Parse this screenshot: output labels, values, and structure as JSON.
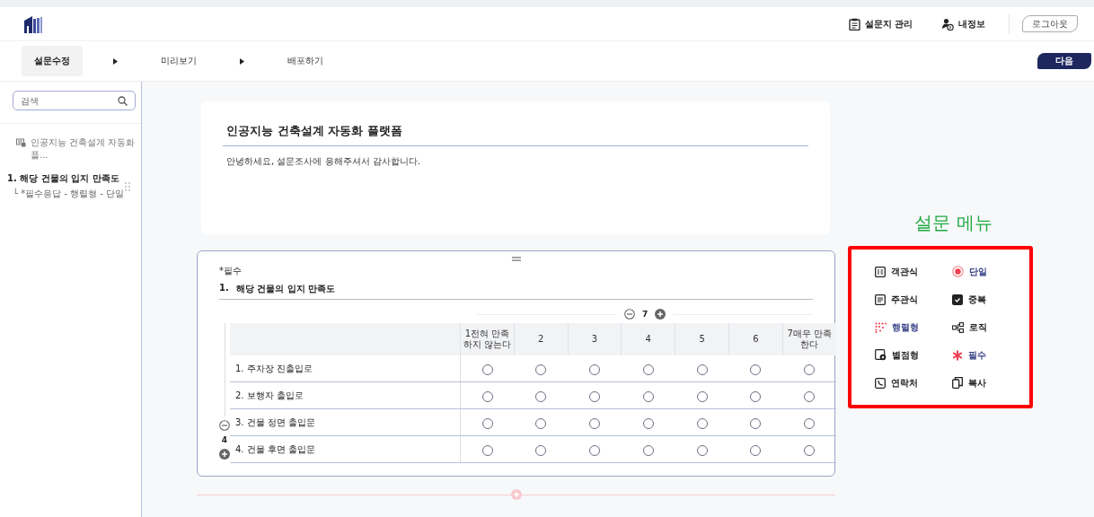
{
  "header": {
    "nav": [
      {
        "label": "설문지 관리",
        "kind": "clipboard"
      },
      {
        "label": "내정보",
        "kind": "user"
      }
    ],
    "logout": "로그아웃"
  },
  "steps": [
    {
      "label": "설문수정",
      "selected": true
    },
    {
      "label": "미리보기",
      "selected": false
    },
    {
      "label": "배포하기",
      "selected": false
    }
  ],
  "next_button": "다음",
  "sidebar": {
    "search": {
      "placeholder": "검색"
    },
    "survey_title": "인공지능 건축설계 자동화 플...",
    "questions": [
      {
        "title": "1. 해당 건물의 입지 만족도",
        "meta": "└ *필수응답 - 행렬형 - 단일",
        "selected": true
      }
    ]
  },
  "title_card": {
    "title": "인공지능 건축설계 자동화 플랫폼",
    "description": "안녕하세요, 설문조사에 응해주셔서 감사합니다."
  },
  "question": {
    "required_label": "*필수",
    "number": "1.",
    "title": "해당 건물의 입지 만족도",
    "scale_count": "7",
    "row_count": "4",
    "columns": [
      "1전혀 만족하지 않는다",
      "2",
      "3",
      "4",
      "5",
      "6",
      "7매우 만족한다"
    ],
    "rows": [
      {
        "label": "1. 주차장 진출입로",
        "cells": [
          {
            "selected": false
          },
          {
            "selected": false
          },
          {
            "selected": false
          },
          {
            "selected": false
          },
          {
            "selected": false
          },
          {
            "selected": false
          },
          {
            "selected": false
          }
        ]
      },
      {
        "label": "2. 보행자 출입로",
        "cells": [
          {
            "selected": false
          },
          {
            "selected": false
          },
          {
            "selected": false
          },
          {
            "selected": false
          },
          {
            "selected": false
          },
          {
            "selected": false
          },
          {
            "selected": false
          }
        ]
      },
      {
        "label": "3. 건물 정면 출입문",
        "cells": [
          {
            "selected": false
          },
          {
            "selected": false
          },
          {
            "selected": false
          },
          {
            "selected": false
          },
          {
            "selected": false
          },
          {
            "selected": false
          },
          {
            "selected": false
          }
        ]
      },
      {
        "label": "4. 건물 후면 출입문",
        "cells": [
          {
            "selected": false
          },
          {
            "selected": false
          },
          {
            "selected": false
          },
          {
            "selected": false
          },
          {
            "selected": false
          },
          {
            "selected": false
          },
          {
            "selected": false
          }
        ]
      }
    ]
  },
  "menu": {
    "heading": "설문 메뉴",
    "items": [
      {
        "label": "객관식",
        "kind": "list",
        "active": false
      },
      {
        "label": "단일",
        "kind": "radio",
        "active": true
      },
      {
        "label": "주관식",
        "kind": "text",
        "active": false
      },
      {
        "label": "중복",
        "kind": "check",
        "active": false
      },
      {
        "label": "행렬형",
        "kind": "matrix",
        "active": true
      },
      {
        "label": "로직",
        "kind": "logic",
        "active": false
      },
      {
        "label": "별점형",
        "kind": "rating",
        "active": false
      },
      {
        "label": "필수",
        "kind": "required",
        "active": true
      },
      {
        "label": "연락처",
        "kind": "contact",
        "active": false
      },
      {
        "label": "복사",
        "kind": "copy",
        "active": false
      }
    ]
  }
}
